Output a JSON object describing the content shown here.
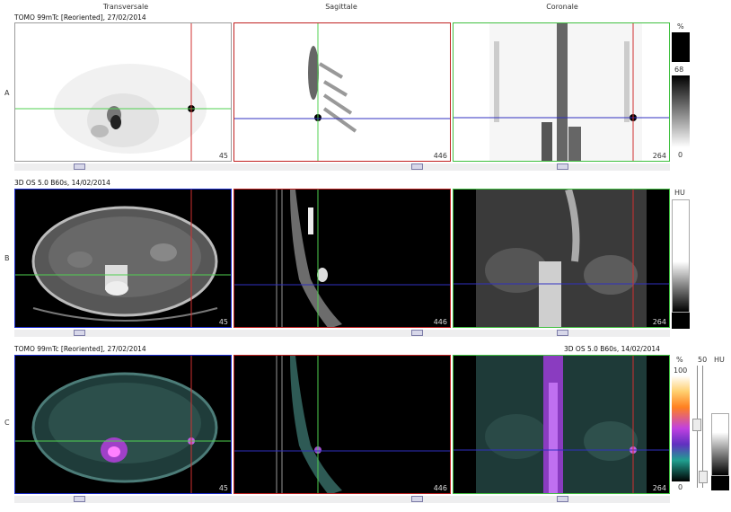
{
  "columns": [
    "Transversale",
    "Sagittale",
    "Coronale"
  ],
  "rows": [
    {
      "letter": "A",
      "title": "TOMO 99mTc [Reoriented], 27/02/2014",
      "slices": [
        "45",
        "446",
        "264"
      ]
    },
    {
      "letter": "B",
      "title": "3D  OS  5.0  B60s, 14/02/2014",
      "slices": [
        "45",
        "446",
        "264"
      ]
    },
    {
      "letter": "C",
      "title": "TOMO 99mTc [Reoriented], 27/02/2014",
      "title_right": "3D  OS  5.0  B60s, 14/02/2014",
      "slices": [
        "45",
        "446",
        "264"
      ]
    }
  ],
  "scale_a": {
    "unit": "%",
    "value": "68",
    "min": "0"
  },
  "scale_b": {
    "unit": "HU"
  },
  "scale_c": {
    "unit": "%",
    "max": "100",
    "min": "0",
    "mix": "50",
    "unit2": "HU"
  },
  "colors": {
    "frame_blue": "#1a2bd0",
    "frame_red": "#c02020",
    "frame_green": "#40c040",
    "cross_green": "#50d050",
    "cross_red": "#d03030",
    "cross_blue": "#3030c0"
  }
}
